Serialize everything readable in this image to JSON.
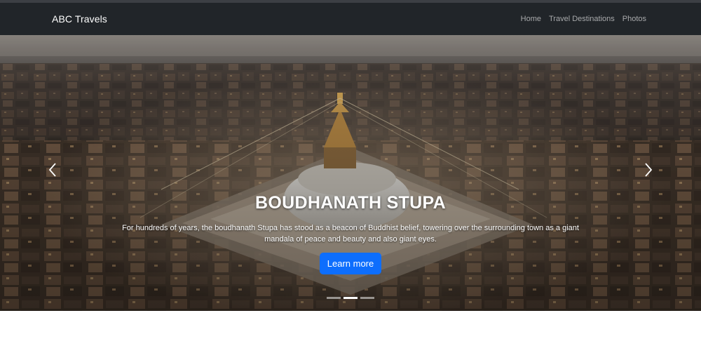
{
  "navbar": {
    "brand": "ABC Travels",
    "links": [
      "Home",
      "Travel Destinations",
      "Photos"
    ]
  },
  "carousel": {
    "slide": {
      "title": "BOUDHANATH STUPA",
      "description": "For hundreds of years, the boudhanath Stupa has stood as a beacon of Buddhist belief, towering over the surrounding town as a giant mandala of peace and beauty and also giant eyes.",
      "button_label": "Learn more"
    },
    "prev_icon": "chevron-left-icon",
    "next_icon": "chevron-right-icon",
    "indicator_count": 3,
    "active_indicator": 2
  },
  "colors": {
    "navbar_bg": "#212529",
    "button_bg": "#0d6efd",
    "page_bg": "#ffffff"
  }
}
